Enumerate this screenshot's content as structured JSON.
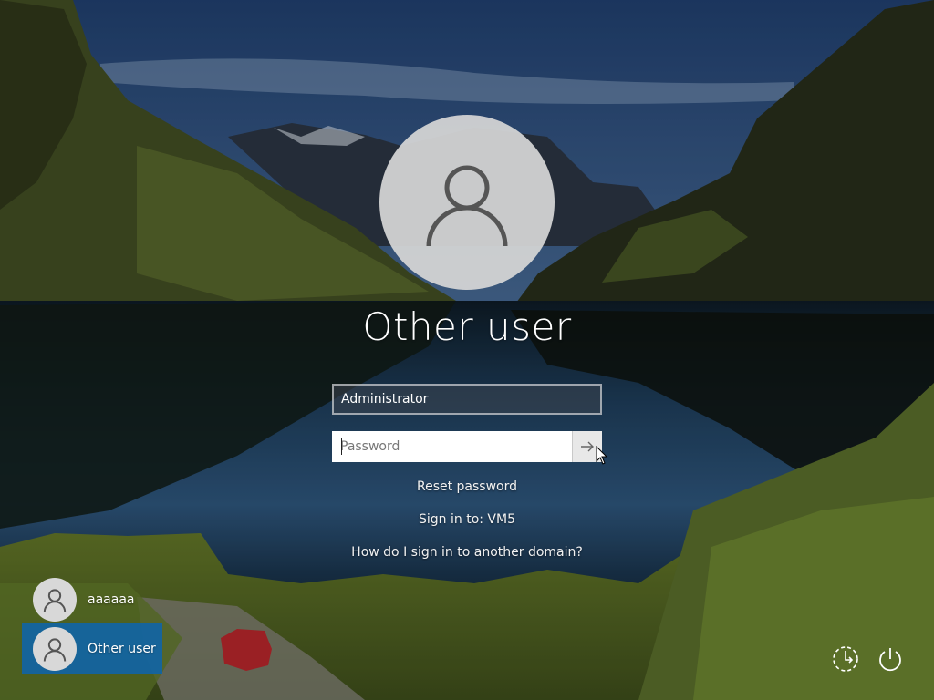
{
  "login": {
    "title": "Other user",
    "username_value": "Administrator",
    "password_placeholder": "Password",
    "reset_password": "Reset password",
    "sign_in_to": "Sign in to: VM5",
    "other_domain": "How do I sign in to another domain?"
  },
  "users": [
    {
      "name": "aaaaaa",
      "selected": false
    },
    {
      "name": "Other user",
      "selected": true
    }
  ],
  "system_icons": [
    "ease-of-access-icon",
    "power-icon"
  ],
  "colors": {
    "selected_tile": "#0f64aa",
    "avatar_bg": "#d6d6d6"
  }
}
